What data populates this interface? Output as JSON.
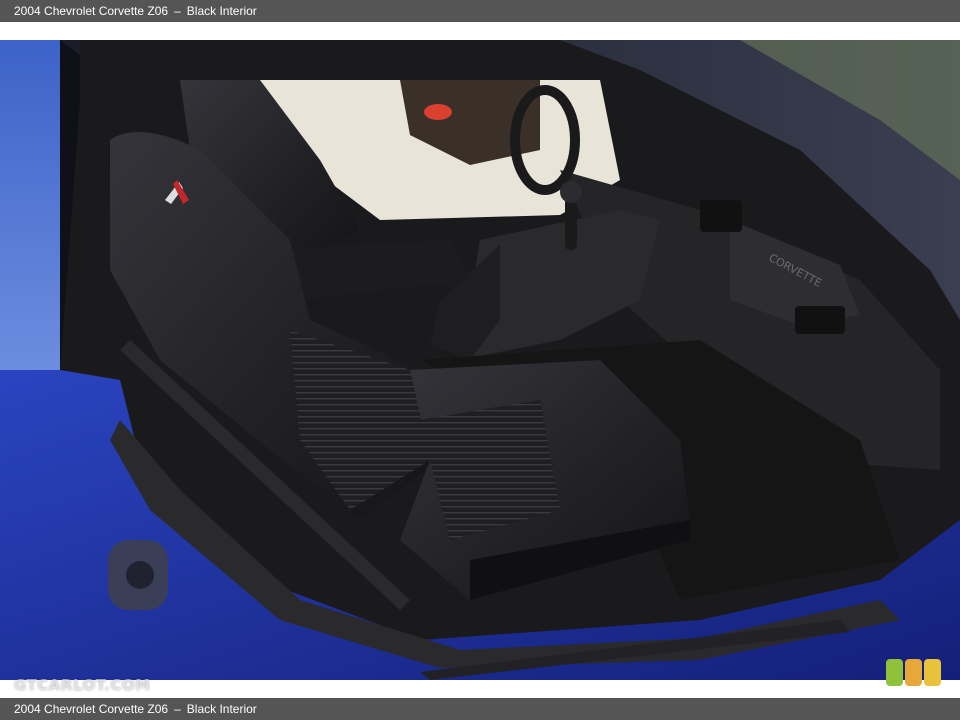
{
  "caption": {
    "title": "2004 Chevrolet Corvette Z06",
    "separator": "–",
    "subtitle": "Black Interior"
  },
  "photo": {
    "subject": "corvette-interior",
    "dash_lettering": "CORVETTE",
    "colors": {
      "body_paint": "#1f35a8",
      "leather": "#1c1c1e",
      "carpet": "#151515",
      "sky": "#4a6fd0",
      "window_light": "#e8e4d8"
    }
  },
  "watermark": {
    "text": "GTCARLOT.COM"
  },
  "rating_badge": {
    "colors": [
      "#8fc23a",
      "#e8a73a",
      "#e8c23a"
    ]
  }
}
